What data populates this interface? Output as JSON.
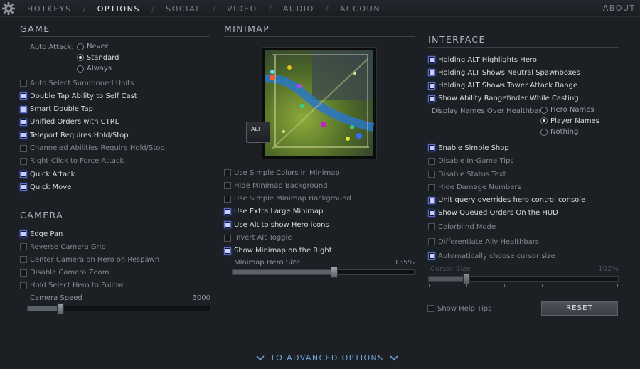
{
  "nav": {
    "tabs": [
      "HOTKEYS",
      "OPTIONS",
      "SOCIAL",
      "VIDEO",
      "AUDIO",
      "ACCOUNT"
    ],
    "active": "OPTIONS",
    "separator": "/",
    "about": "ABOUT"
  },
  "game": {
    "title": "GAME",
    "auto_attack_label": "Auto Attack:",
    "auto_attack_options": [
      "Never",
      "Standard",
      "Always"
    ],
    "auto_attack_selected": "Standard",
    "options": [
      {
        "label": "Auto Select Summoned Units",
        "checked": false,
        "enabled": false
      },
      {
        "label": "Double Tap Ability to Self Cast",
        "checked": true,
        "enabled": true
      },
      {
        "label": "Smart Double Tap",
        "checked": true,
        "enabled": true
      },
      {
        "label": "Unified Orders with CTRL",
        "checked": true,
        "enabled": true
      },
      {
        "label": "Teleport Requires Hold/Stop",
        "checked": true,
        "enabled": true
      },
      {
        "label": "Channeled Abilities Require Hold/Stop",
        "checked": false,
        "enabled": false
      },
      {
        "label": "Right-Click to Force Attack",
        "checked": false,
        "enabled": false
      },
      {
        "label": "Quick Attack",
        "checked": true,
        "enabled": true
      },
      {
        "label": "Quick Move",
        "checked": true,
        "enabled": true
      }
    ]
  },
  "camera": {
    "title": "CAMERA",
    "options": [
      {
        "label": "Edge Pan",
        "checked": true,
        "enabled": true
      },
      {
        "label": "Reverse Camera Grip",
        "checked": false,
        "enabled": false
      },
      {
        "label": "Center Camera on Hero on Respawn",
        "checked": false,
        "enabled": false
      },
      {
        "label": "Disable Camera Zoom",
        "checked": false,
        "enabled": false
      },
      {
        "label": "Hold Select Hero to Follow",
        "checked": false,
        "enabled": false
      }
    ],
    "speed_label": "Camera Speed",
    "speed_value": "3000",
    "speed_fraction": 0.18
  },
  "minimap": {
    "title": "MINIMAP",
    "alt_key": "ALT",
    "options": [
      {
        "label": "Use Simple Colors in Minimap",
        "checked": false,
        "enabled": false
      },
      {
        "label": "Hide Minimap Background",
        "checked": false,
        "enabled": false
      },
      {
        "label": "Use Simple Minimap Background",
        "checked": false,
        "enabled": false
      },
      {
        "label": "Use Extra Large Minimap",
        "checked": true,
        "enabled": true
      },
      {
        "label": "Use Alt to show Hero icons",
        "checked": true,
        "enabled": true
      },
      {
        "label": "Invert Alt Toggle",
        "checked": false,
        "enabled": false
      },
      {
        "label": "Show Minimap on the Right",
        "checked": true,
        "enabled": true
      }
    ],
    "hero_size_label": "Minimap Hero Size",
    "hero_size_value": "135%",
    "hero_size_fraction": 0.56
  },
  "interface": {
    "title": "INTERFACE",
    "options_a": [
      {
        "label": "Holding ALT Highlights Hero",
        "checked": true,
        "enabled": true
      },
      {
        "label": "Holding ALT Shows Neutral Spawnboxes",
        "checked": true,
        "enabled": true
      },
      {
        "label": "Holding ALT Shows Tower Attack Range",
        "checked": true,
        "enabled": true
      },
      {
        "label": "Show Ability Rangefinder While Casting",
        "checked": true,
        "enabled": true
      }
    ],
    "display_names_label": "Display Names Over Healthbar",
    "display_names_options": [
      "Hero Names",
      "Player Names",
      "Nothing"
    ],
    "display_names_selected": "Player Names",
    "options_b": [
      {
        "label": "Enable Simple Shop",
        "checked": true,
        "enabled": true
      },
      {
        "label": "Disable In-Game Tips",
        "checked": false,
        "enabled": false
      },
      {
        "label": "Disable Status Text",
        "checked": false,
        "enabled": false
      },
      {
        "label": "Hide Damage Numbers",
        "checked": false,
        "enabled": false
      },
      {
        "label": "Unit query overrides hero control console",
        "checked": true,
        "enabled": true
      },
      {
        "label": "Show Queued Orders On the HUD",
        "checked": true,
        "enabled": true
      },
      {
        "label": "Colorblind Mode",
        "checked": false,
        "enabled": false
      },
      {
        "label": "Differentiate Ally Healthbars",
        "checked": false,
        "enabled": false
      },
      {
        "label": "Automatically choose cursor size",
        "checked": true,
        "enabled": false
      }
    ],
    "cursor_size_label": "Cursor Size",
    "cursor_size_value": "102%",
    "cursor_size_fraction": 0.2,
    "show_help_tips": "Show Help Tips",
    "reset": "RESET"
  },
  "advanced": "TO ADVANCED OPTIONS",
  "colors": {
    "accent_checked": "#5b6dc7",
    "link": "#6ea2d8",
    "background": "#1c1f24"
  }
}
